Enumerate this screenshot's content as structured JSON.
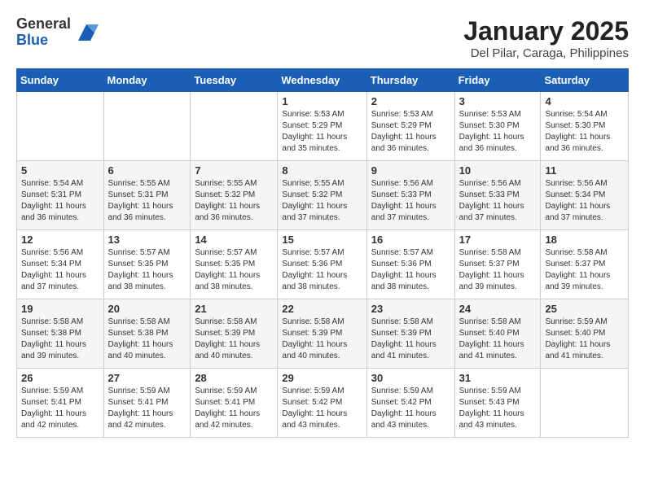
{
  "logo": {
    "general": "General",
    "blue": "Blue"
  },
  "title": "January 2025",
  "location": "Del Pilar, Caraga, Philippines",
  "weekdays": [
    "Sunday",
    "Monday",
    "Tuesday",
    "Wednesday",
    "Thursday",
    "Friday",
    "Saturday"
  ],
  "weeks": [
    [
      {
        "day": "",
        "info": ""
      },
      {
        "day": "",
        "info": ""
      },
      {
        "day": "",
        "info": ""
      },
      {
        "day": "1",
        "info": "Sunrise: 5:53 AM\nSunset: 5:29 PM\nDaylight: 11 hours\nand 35 minutes."
      },
      {
        "day": "2",
        "info": "Sunrise: 5:53 AM\nSunset: 5:29 PM\nDaylight: 11 hours\nand 36 minutes."
      },
      {
        "day": "3",
        "info": "Sunrise: 5:53 AM\nSunset: 5:30 PM\nDaylight: 11 hours\nand 36 minutes."
      },
      {
        "day": "4",
        "info": "Sunrise: 5:54 AM\nSunset: 5:30 PM\nDaylight: 11 hours\nand 36 minutes."
      }
    ],
    [
      {
        "day": "5",
        "info": "Sunrise: 5:54 AM\nSunset: 5:31 PM\nDaylight: 11 hours\nand 36 minutes."
      },
      {
        "day": "6",
        "info": "Sunrise: 5:55 AM\nSunset: 5:31 PM\nDaylight: 11 hours\nand 36 minutes."
      },
      {
        "day": "7",
        "info": "Sunrise: 5:55 AM\nSunset: 5:32 PM\nDaylight: 11 hours\nand 36 minutes."
      },
      {
        "day": "8",
        "info": "Sunrise: 5:55 AM\nSunset: 5:32 PM\nDaylight: 11 hours\nand 37 minutes."
      },
      {
        "day": "9",
        "info": "Sunrise: 5:56 AM\nSunset: 5:33 PM\nDaylight: 11 hours\nand 37 minutes."
      },
      {
        "day": "10",
        "info": "Sunrise: 5:56 AM\nSunset: 5:33 PM\nDaylight: 11 hours\nand 37 minutes."
      },
      {
        "day": "11",
        "info": "Sunrise: 5:56 AM\nSunset: 5:34 PM\nDaylight: 11 hours\nand 37 minutes."
      }
    ],
    [
      {
        "day": "12",
        "info": "Sunrise: 5:56 AM\nSunset: 5:34 PM\nDaylight: 11 hours\nand 37 minutes."
      },
      {
        "day": "13",
        "info": "Sunrise: 5:57 AM\nSunset: 5:35 PM\nDaylight: 11 hours\nand 38 minutes."
      },
      {
        "day": "14",
        "info": "Sunrise: 5:57 AM\nSunset: 5:35 PM\nDaylight: 11 hours\nand 38 minutes."
      },
      {
        "day": "15",
        "info": "Sunrise: 5:57 AM\nSunset: 5:36 PM\nDaylight: 11 hours\nand 38 minutes."
      },
      {
        "day": "16",
        "info": "Sunrise: 5:57 AM\nSunset: 5:36 PM\nDaylight: 11 hours\nand 38 minutes."
      },
      {
        "day": "17",
        "info": "Sunrise: 5:58 AM\nSunset: 5:37 PM\nDaylight: 11 hours\nand 39 minutes."
      },
      {
        "day": "18",
        "info": "Sunrise: 5:58 AM\nSunset: 5:37 PM\nDaylight: 11 hours\nand 39 minutes."
      }
    ],
    [
      {
        "day": "19",
        "info": "Sunrise: 5:58 AM\nSunset: 5:38 PM\nDaylight: 11 hours\nand 39 minutes."
      },
      {
        "day": "20",
        "info": "Sunrise: 5:58 AM\nSunset: 5:38 PM\nDaylight: 11 hours\nand 40 minutes."
      },
      {
        "day": "21",
        "info": "Sunrise: 5:58 AM\nSunset: 5:39 PM\nDaylight: 11 hours\nand 40 minutes."
      },
      {
        "day": "22",
        "info": "Sunrise: 5:58 AM\nSunset: 5:39 PM\nDaylight: 11 hours\nand 40 minutes."
      },
      {
        "day": "23",
        "info": "Sunrise: 5:58 AM\nSunset: 5:39 PM\nDaylight: 11 hours\nand 41 minutes."
      },
      {
        "day": "24",
        "info": "Sunrise: 5:58 AM\nSunset: 5:40 PM\nDaylight: 11 hours\nand 41 minutes."
      },
      {
        "day": "25",
        "info": "Sunrise: 5:59 AM\nSunset: 5:40 PM\nDaylight: 11 hours\nand 41 minutes."
      }
    ],
    [
      {
        "day": "26",
        "info": "Sunrise: 5:59 AM\nSunset: 5:41 PM\nDaylight: 11 hours\nand 42 minutes."
      },
      {
        "day": "27",
        "info": "Sunrise: 5:59 AM\nSunset: 5:41 PM\nDaylight: 11 hours\nand 42 minutes."
      },
      {
        "day": "28",
        "info": "Sunrise: 5:59 AM\nSunset: 5:41 PM\nDaylight: 11 hours\nand 42 minutes."
      },
      {
        "day": "29",
        "info": "Sunrise: 5:59 AM\nSunset: 5:42 PM\nDaylight: 11 hours\nand 43 minutes."
      },
      {
        "day": "30",
        "info": "Sunrise: 5:59 AM\nSunset: 5:42 PM\nDaylight: 11 hours\nand 43 minutes."
      },
      {
        "day": "31",
        "info": "Sunrise: 5:59 AM\nSunset: 5:43 PM\nDaylight: 11 hours\nand 43 minutes."
      },
      {
        "day": "",
        "info": ""
      }
    ]
  ]
}
